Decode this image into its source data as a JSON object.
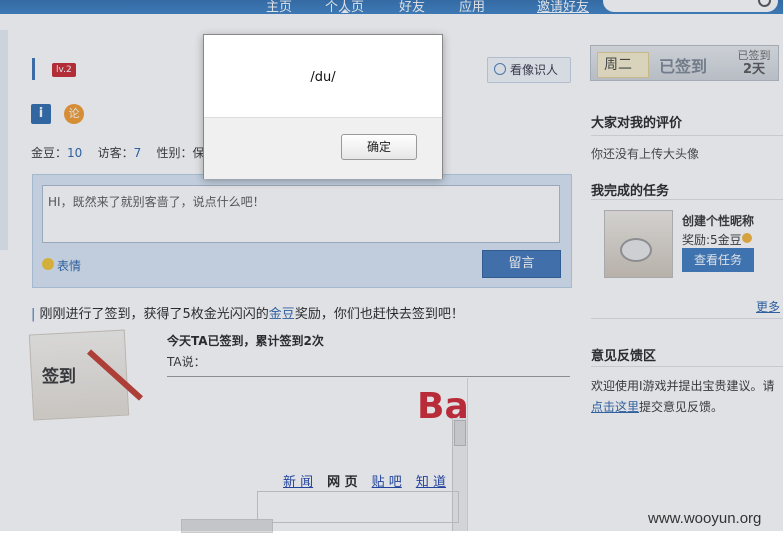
{
  "nav": {
    "items": [
      "主页",
      "个人页",
      "好友",
      "应用",
      "邀请好友"
    ]
  },
  "profile": {
    "level": "lv.2",
    "recognize_btn": "看像识人",
    "app1": "i",
    "app2": "论"
  },
  "stats": {
    "gold_label": "金豆：",
    "gold": "10",
    "visitors_label": "访客：",
    "visitors": "7",
    "gender_label": "性别：保密"
  },
  "message": {
    "placeholder": "HI，既然来了就别客啬了，说点什么吧！",
    "emoji": "表情",
    "submit": "留言"
  },
  "checkin": {
    "prefix": "刚刚进行了签到，获得了5枚金光闪闪的",
    "link": "金豆",
    "suffix": "奖励，你们也赶快去签到吧！",
    "card_label": "签到",
    "today": "今天TA已签到，累计签到2次",
    "ta_said": "TA说："
  },
  "baidu": {
    "logo": "Ba",
    "links": [
      "新 闻",
      "网 页",
      "贴 吧",
      "知 道"
    ]
  },
  "right": {
    "weekday": "周二",
    "signed": "已签到",
    "signed_days_label": "已签到",
    "signed_days": "2天",
    "eval_title": "大家对我的评价",
    "eval_text": "你还没有上传大头像",
    "task_title": "我完成的任务",
    "task_name": "创建个性昵称",
    "task_reward": "奖励:5金豆",
    "task_btn": "查看任务",
    "more": "更多",
    "fb_title": "意见反馈区",
    "fb_text1": "欢迎使用I游戏并提出宝贵建议。请",
    "fb_link": "点击这里",
    "fb_text2": "提交意见反馈。"
  },
  "dialog": {
    "message": "/du/",
    "ok": "确定"
  },
  "watermark": "www.wooyun.org"
}
